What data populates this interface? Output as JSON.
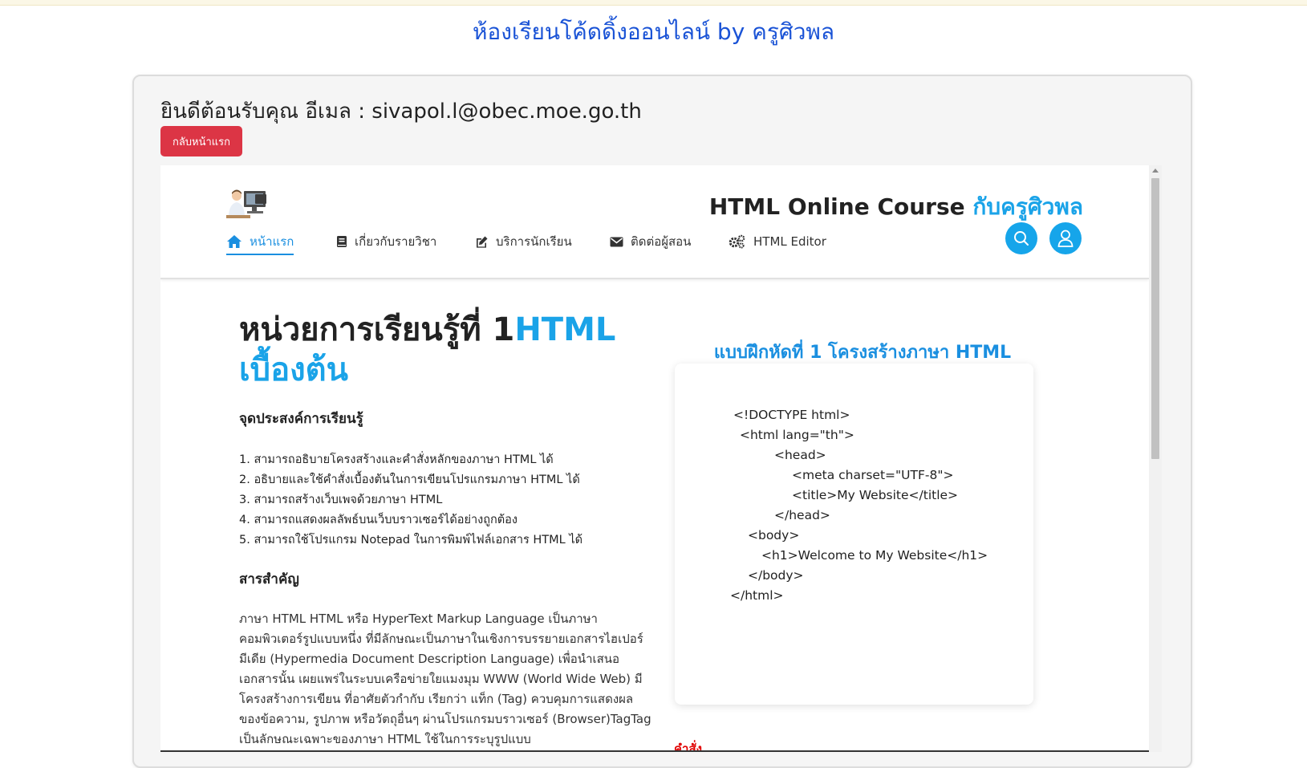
{
  "site": {
    "title": "ห้องเรียนโค้ดดิ้งออนไลน์ by ครูศิวพล"
  },
  "welcome": {
    "text": "ยินดีต้อนรับคุณ อีเมล : sivapol.l@obec.moe.go.th"
  },
  "back_button": {
    "label": "กลับหน้าแรก"
  },
  "course": {
    "title_main": "HTML Online Course ",
    "title_accent": "กับครูศิวพล",
    "nav": [
      {
        "label": "หน้าแรก",
        "icon": "home-icon",
        "active": true
      },
      {
        "label": "เกี่ยวกับรายวิชา",
        "icon": "book-icon",
        "active": false
      },
      {
        "label": "บริการนักเรียน",
        "icon": "edit-icon",
        "active": false
      },
      {
        "label": "ติดต่อผู้สอน",
        "icon": "envelope-icon",
        "active": false
      },
      {
        "label": "HTML Editor",
        "icon": "gears-icon",
        "active": false
      }
    ],
    "search_icon": "search-icon",
    "user_icon": "user-icon"
  },
  "unit": {
    "title_main": "หน่วยการเรียนรู้ที่ 1",
    "title_accent": "HTML เบื้องต้น",
    "objectives_heading": "จุดประสงค์การเรียนรู้",
    "objectives": [
      "1. สามารถอธิบายโครงสร้างและคำสั่งหลักของภาษา HTML ได้",
      "2. อธิบายและใช้คำสั่งเบื้องต้นในการเขียนโปรแกรมภาษา HTML ได้",
      "3. สามารถสร้างเว็บเพจด้วยภาษา HTML",
      "4. สามารถแสดงผลลัพธ์บนเว็บบราวเซอร์ได้อย่างถูกต้อง",
      "5. สามารถใช้โปรแกรม Notepad ในการพิมพ์ไฟล์เอกสาร HTML ได้"
    ],
    "key_heading": "สารสำคัญ",
    "key_text": "ภาษา HTML HTML หรือ HyperText Markup Language เป็นภาษาคอมพิวเตอร์รูปแบบหนึ่ง ที่มีลักษณะเป็นภาษาในเชิงการบรรยายเอกสารไฮเปอร์มีเดีย (Hypermedia Document Description Language) เพื่อนำเสนอเอกสารนั้น เผยแพร่ในระบบเครือข่ายใยแมงมุม WWW (World Wide Web) มีโครงสร้างการเขียน ที่อาศัยตัวกำกับ เรียกว่า แท็ก (Tag) ควบคุมการแสดงผลของข้อความ, รูปภาพ หรือวัตถุอื่นๆ ผ่านโปรแกรมบราวเซอร์ (Browser)TagTag เป็นลักษณะเฉพาะของภาษา HTML ใช้ในการระบุรูปแบบ"
  },
  "exercise": {
    "title": "แบบฝึกหัดที่ 1 โครงสร้างภาษา HTML",
    "code": [
      "<!DOCTYPE html>",
      "<html lang=\"th\">",
      "<head>",
      "<meta charset=\"UTF-8\">",
      "<title>My Website</title>",
      "</head>",
      "<body>",
      "<h1>Welcome to My Website</h1>",
      "</body>",
      "</html>"
    ],
    "command_label": "คำสั่ง"
  },
  "colors": {
    "accent": "#1aa3e8",
    "danger": "#dc3545",
    "title_blue": "#1a53d6"
  }
}
